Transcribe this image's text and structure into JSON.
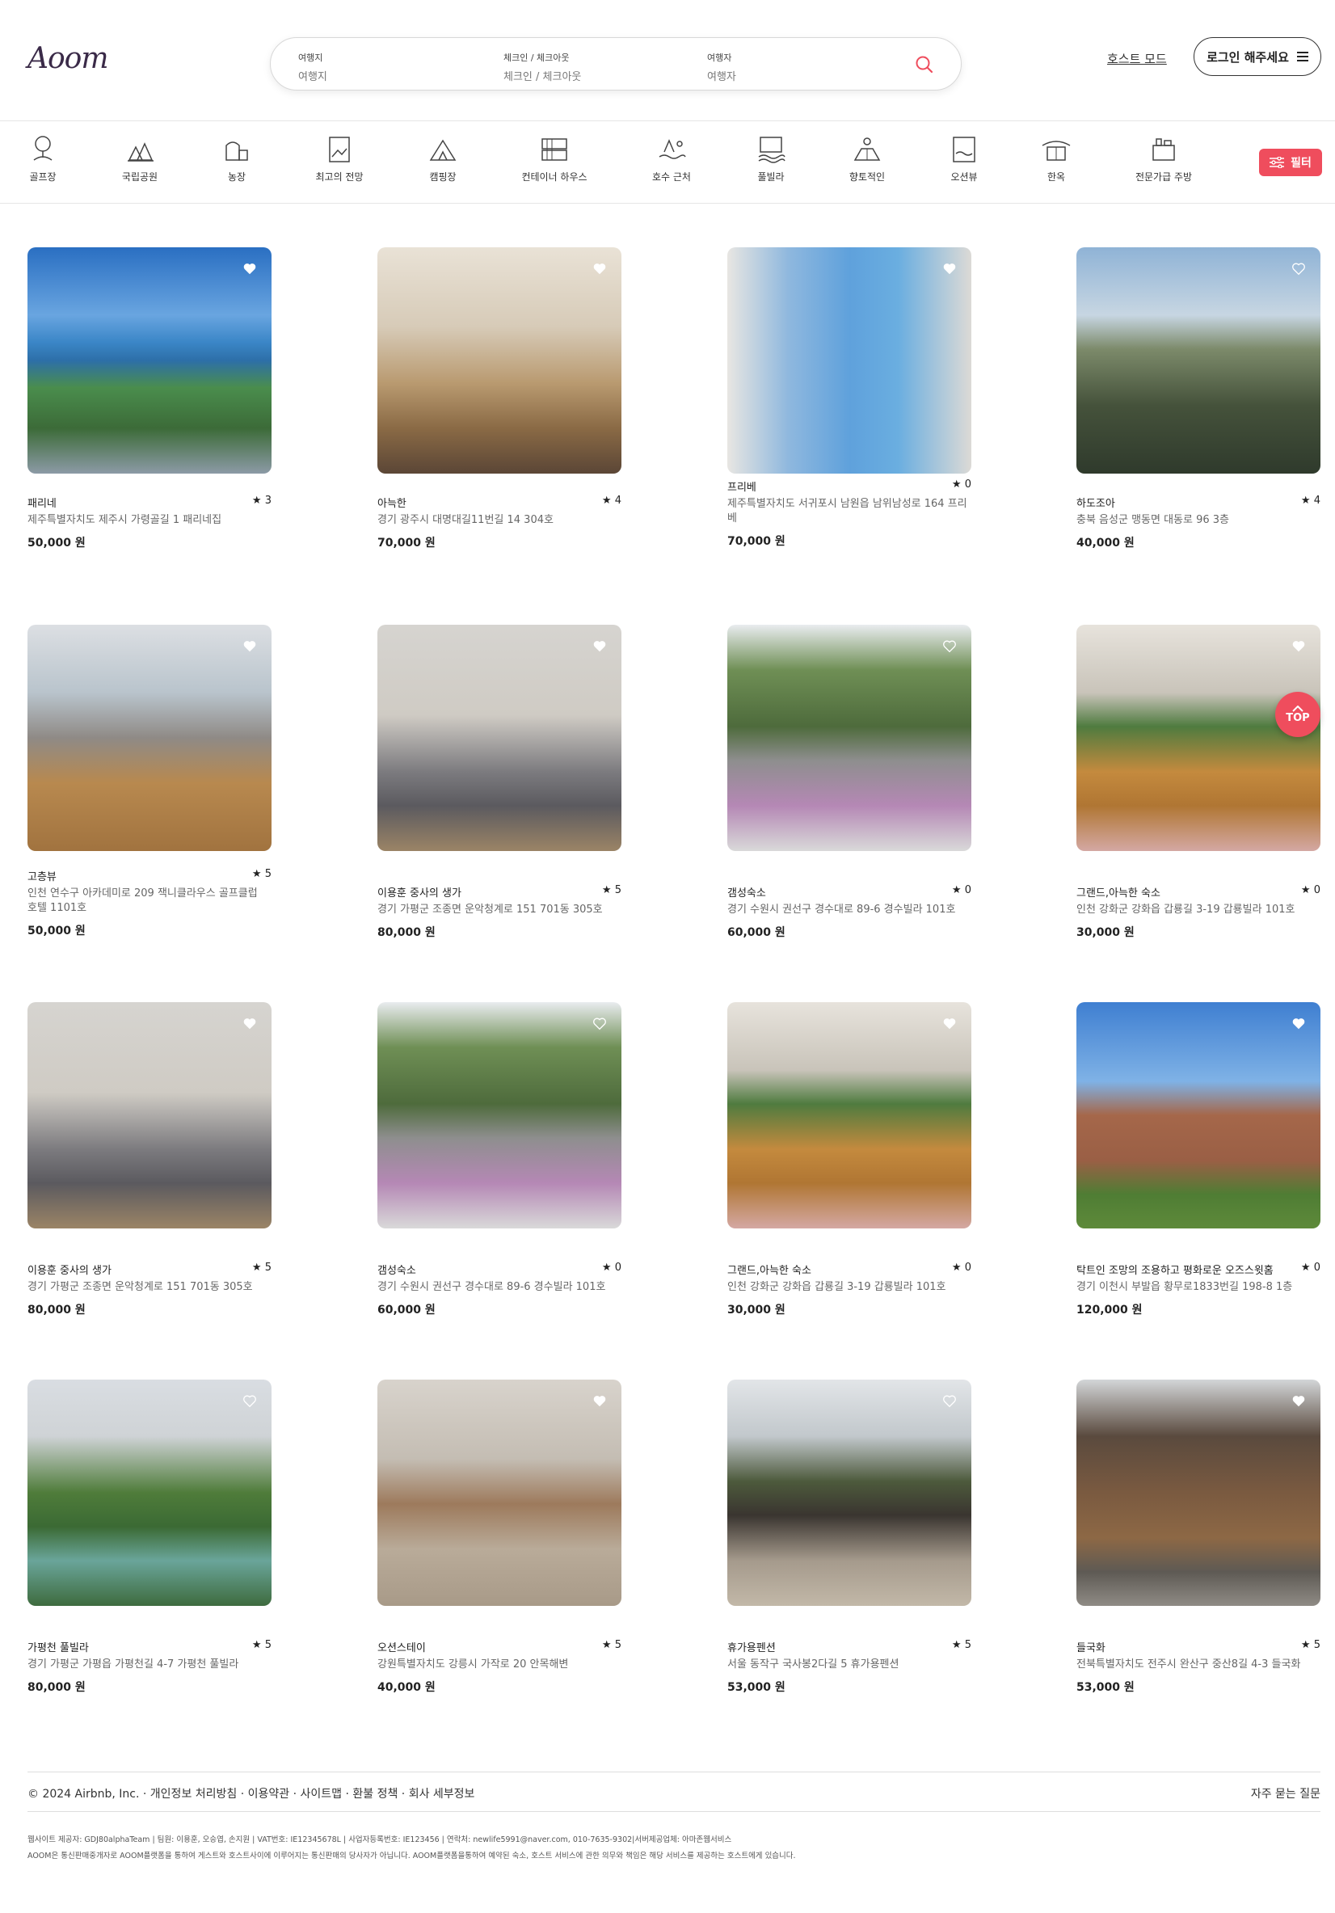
{
  "header": {
    "logo_text": "Aoom",
    "search": {
      "destination_label": "여행지",
      "destination_value": "여행지",
      "dates_label": "체크인 / 체크아웃",
      "dates_value": "체크인 / 체크아웃",
      "guests_label": "여행자",
      "guests_value": "여행자"
    },
    "host_mode": "호스트 모드",
    "login": "로그인 해주세요"
  },
  "categories": [
    "골프장",
    "국립공원",
    "농장",
    "최고의 전망",
    "캠핑장",
    "컨테이너 하우스",
    "호수 근처",
    "풀빌라",
    "향토적인",
    "오션뷰",
    "한옥",
    "전문가급 주방"
  ],
  "filter_label": "필터",
  "top_label": "TOP",
  "listings": [
    {
      "title": "패리네",
      "rating": "3",
      "address": "제주특별자치도 제주시 가령골길 1 패리네집",
      "price": "50,000 원"
    },
    {
      "title": "아늑한",
      "rating": "4",
      "address": "경기 광주시 대명대길11번길 14 304호",
      "price": "70,000 원"
    },
    {
      "title": "프리베",
      "rating": "0",
      "address": "제주특별자치도 서귀포시 남원읍 남위남성로 164 프리베",
      "price": "70,000 원"
    },
    {
      "title": "하도조아",
      "rating": "4",
      "address": "충북 음성군 맹동면 대동로 96 3층",
      "price": "40,000 원"
    },
    {
      "title": "고층뷰",
      "rating": "5",
      "address": "인천 연수구 아카데미로 209 잭니클라우스 골프클럽 호텔 1101호",
      "price": "50,000 원"
    },
    {
      "title": "이용훈 중사의 생가",
      "rating": "5",
      "address": "경기 가평군 조종면 운악청계로 151 701동 305호",
      "price": "80,000 원"
    },
    {
      "title": "갬성숙소",
      "rating": "0",
      "address": "경기 수원시 권선구 경수대로 89-6 경수빌라 101호",
      "price": "60,000 원"
    },
    {
      "title": "그랜드,아늑한 숙소",
      "rating": "0",
      "address": "인천 강화군 강화읍 갑룡길 3-19 갑룡빌라 101호",
      "price": "30,000 원"
    },
    {
      "title": "이용훈 중사의 생가",
      "rating": "5",
      "address": "경기 가평군 조종면 운악청계로 151 701동 305호",
      "price": "80,000 원"
    },
    {
      "title": "갬성숙소",
      "rating": "0",
      "address": "경기 수원시 권선구 경수대로 89-6 경수빌라 101호",
      "price": "60,000 원"
    },
    {
      "title": "그랜드,아늑한 숙소",
      "rating": "0",
      "address": "인천 강화군 강화읍 갑룡길 3-19 갑룡빌라 101호",
      "price": "30,000 원"
    },
    {
      "title": "탁트인 조망의 조용하고 평화로운 오즈스윗홈",
      "rating": "0",
      "address": "경기 이천시 부발읍 황무로1833번길 198-8 1층",
      "price": "120,000 원"
    },
    {
      "title": "가평천 풀빌라",
      "rating": "5",
      "address": "경기 가평군 가평읍 가평천길 4-7 가평천 풀빌라",
      "price": "80,000 원"
    },
    {
      "title": "오션스테이",
      "rating": "5",
      "address": "강원특별자치도 강릉시 가작로 20 안목해변",
      "price": "40,000 원"
    },
    {
      "title": "휴가용펜션",
      "rating": "5",
      "address": "서울 동작구 국사봉2다길 5 휴가용펜션",
      "price": "53,000 원"
    },
    {
      "title": "들국화",
      "rating": "5",
      "address": "전북특별자치도 전주시 완산구 중산8길 4-3 들국화",
      "price": "53,000 원"
    }
  ],
  "footer": {
    "links": "© 2024 Airbnb, Inc. · 개인정보 처리방침 · 이용약관 · 사이트맵 · 환불 정책 · 회사 세부정보",
    "faq": "자주 묻는 질문",
    "info_line1": "웹사이트 제공자: GDJ80alphaTeam | 팀원: 이용훈, 오승엽, 손지원 | VAT번호: IE12345678L | 사업자등록번호: IE123456 | 연락처: newlife5991@naver.com, 010-7635-9302|서버제공업체: 아마존웹서비스",
    "info_line2": "AOOM은 통신판매중개자로 AOOM플랫폼을 통하여 게스트와 호스트사이에 이루어지는 통신판매의 당사자가 아닙니다. AOOM플랫폼을통하여 예약된 숙소, 호스트 서비스에 관한 의무와 책임은 해당 서비스를 제공하는 호스트에게 있습니다."
  }
}
